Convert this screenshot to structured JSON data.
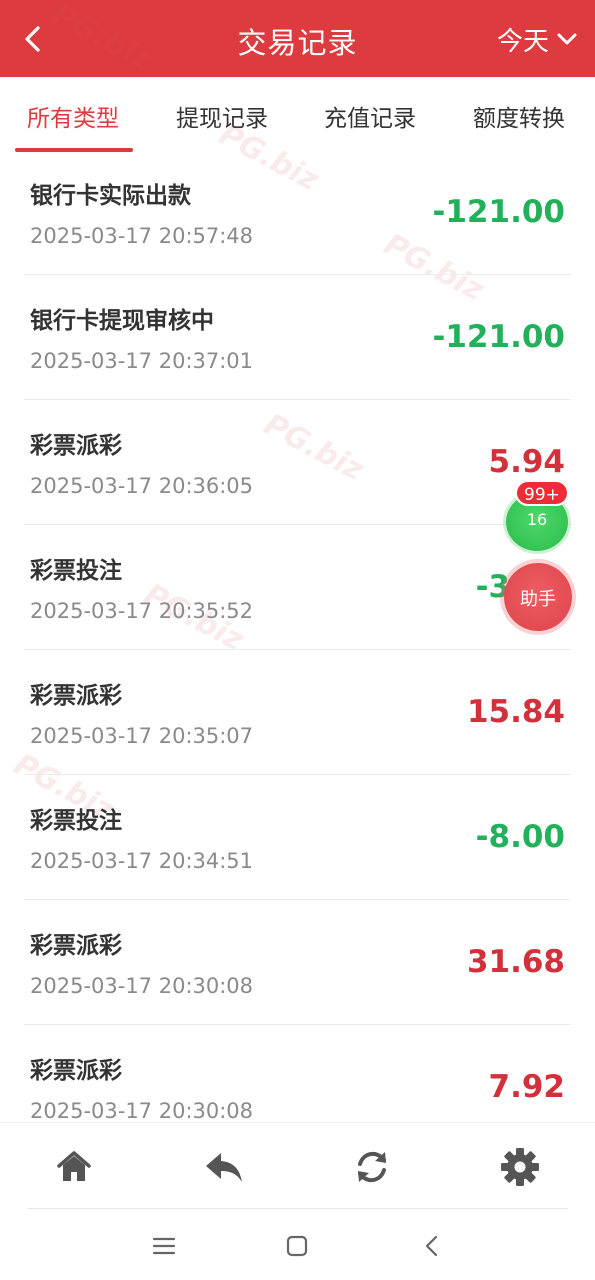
{
  "header": {
    "title": "交易记录",
    "period": "今天",
    "back_icon": "chevron-left-icon",
    "period_icon": "chevron-down-icon",
    "background": "#dd3b3f"
  },
  "tabs": [
    {
      "label": "所有类型",
      "active": true
    },
    {
      "label": "提现记录",
      "active": false
    },
    {
      "label": "充值记录",
      "active": false
    },
    {
      "label": "额度转换",
      "active": false
    }
  ],
  "records": [
    {
      "name": "银行卡实际出款",
      "time": "2025-03-17 20:57:48",
      "amount": "-121.00",
      "sign": "neg"
    },
    {
      "name": "银行卡提现审核中",
      "time": "2025-03-17 20:37:01",
      "amount": "-121.00",
      "sign": "neg"
    },
    {
      "name": "彩票派彩",
      "time": "2025-03-17 20:36:05",
      "amount": "5.94",
      "sign": "pos"
    },
    {
      "name": "彩票投注",
      "time": "2025-03-17 20:35:52",
      "amount": "-3.00",
      "sign": "neg"
    },
    {
      "name": "彩票派彩",
      "time": "2025-03-17 20:35:07",
      "amount": "15.84",
      "sign": "pos"
    },
    {
      "name": "彩票投注",
      "time": "2025-03-17 20:34:51",
      "amount": "-8.00",
      "sign": "neg"
    },
    {
      "name": "彩票派彩",
      "time": "2025-03-17 20:30:08",
      "amount": "31.68",
      "sign": "pos"
    },
    {
      "name": "彩票派彩",
      "time": "2025-03-17 20:30:08",
      "amount": "7.92",
      "sign": "pos"
    }
  ],
  "floating": {
    "badge": "99+",
    "count": "16",
    "assistant_label": "助手"
  },
  "watermark": "PG.biz",
  "toolbar": {
    "icons": [
      "home-icon",
      "reply-icon",
      "refresh-icon",
      "gear-icon"
    ]
  },
  "system_nav": {
    "icons": [
      "menu-icon",
      "home-square-icon",
      "back-icon"
    ]
  },
  "colors": {
    "accent": "#dd3b3f",
    "negative": "#22b15a",
    "positive": "#d2303a"
  }
}
